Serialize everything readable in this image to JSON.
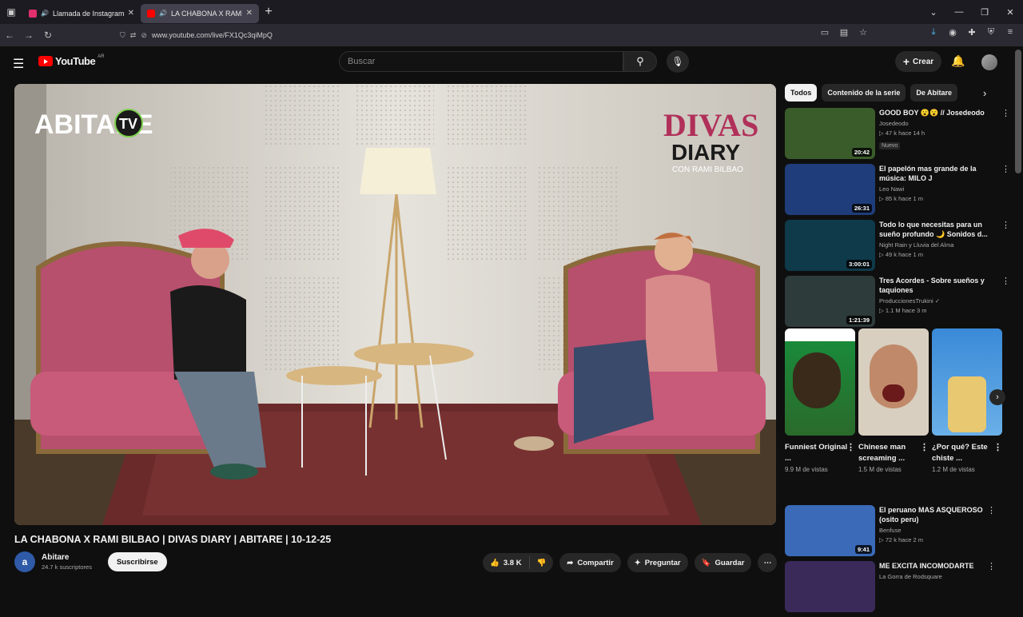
{
  "browser": {
    "tabs": [
      {
        "label": "Llamada de Instagram",
        "favicon_color": "#e1306c"
      },
      {
        "label": "LA CHABONA X RAMI BILBAO",
        "favicon_color": "#ff0000"
      }
    ],
    "url": "www.youtube.com/live/FX1Qc3qiMpQ"
  },
  "header": {
    "logo_text": "YouTube",
    "country": "AR",
    "search_placeholder": "Buscar",
    "create_label": "Crear"
  },
  "player": {
    "brand_left": "ABITARE",
    "brand_left_tv": "TV",
    "brand_right_1": "DIVAS",
    "brand_right_2": "DIARY",
    "brand_right_3": "CON RAMI BILBAO"
  },
  "video": {
    "title": "LA CHABONA X RAMI BILBAO | DIVAS DIARY | ABITARE | 10-12-25",
    "channel": "Abitare",
    "subscribers": "24.7 k suscriptores",
    "subscribe_label": "Suscribirse",
    "likes": "3.8 K",
    "share_label": "Compartir",
    "ask_label": "Preguntar",
    "save_label": "Guardar"
  },
  "sidebar": {
    "chips": [
      "Todos",
      "Contenido de la serie",
      "De Abitare"
    ],
    "recommendations": [
      {
        "title": "GOOD BOY 😮😮 // Josedeodo",
        "channel": "Josedeodo",
        "meta": "▷ 47 k  hace 14 h",
        "badge": "Nuevo",
        "duration": "20:42",
        "thumb_color": "#3a5c2a"
      },
      {
        "title": "El papelón mas grande de la música: MILO J",
        "channel": "Leo Nawi",
        "meta": "▷ 85 k  hace 1 m",
        "badge": "",
        "duration": "26:31",
        "thumb_color": "#1f3d7a"
      },
      {
        "title": "Todo lo que necesitas para un sueño profundo 🌙 Sonidos d...",
        "channel": "Night Rain y Lluvia del Alma",
        "meta": "▷ 49 k  hace 1 m",
        "badge": "",
        "duration": "3:00:01",
        "thumb_color": "#0e3a4a"
      },
      {
        "title": "Tres Acordes - Sobre sueños y taquiones",
        "channel": "ProduccionesTrukini ✓",
        "meta": "▷ 1.1 M  hace 3 m",
        "badge": "",
        "duration": "1:21:39",
        "thumb_color": "#2d3b3a"
      }
    ],
    "shorts": [
      {
        "title": "Funniest Original ...",
        "views": "9.9 M de vistas",
        "color": "#1a8a3a"
      },
      {
        "title": "Chinese man screaming ...",
        "views": "1.5 M de vistas",
        "color": "#b07a5a"
      },
      {
        "title": "¿Por qué? Este chiste ...",
        "views": "1.2 M de vistas",
        "color": "#3a8ad8"
      }
    ],
    "more": [
      {
        "title": "El peruano MAS ASQUEROSO (osito peru)",
        "channel": "Benfuse",
        "meta": "▷ 72 k  hace 2 m",
        "duration": "9:41",
        "thumb_color": "#3a6ab8"
      },
      {
        "title": "ME EXCITA INCOMODARTE",
        "channel": "La Gorra de Rodsquare",
        "meta": "",
        "duration": "",
        "thumb_color": "#3a2a5a"
      }
    ]
  }
}
